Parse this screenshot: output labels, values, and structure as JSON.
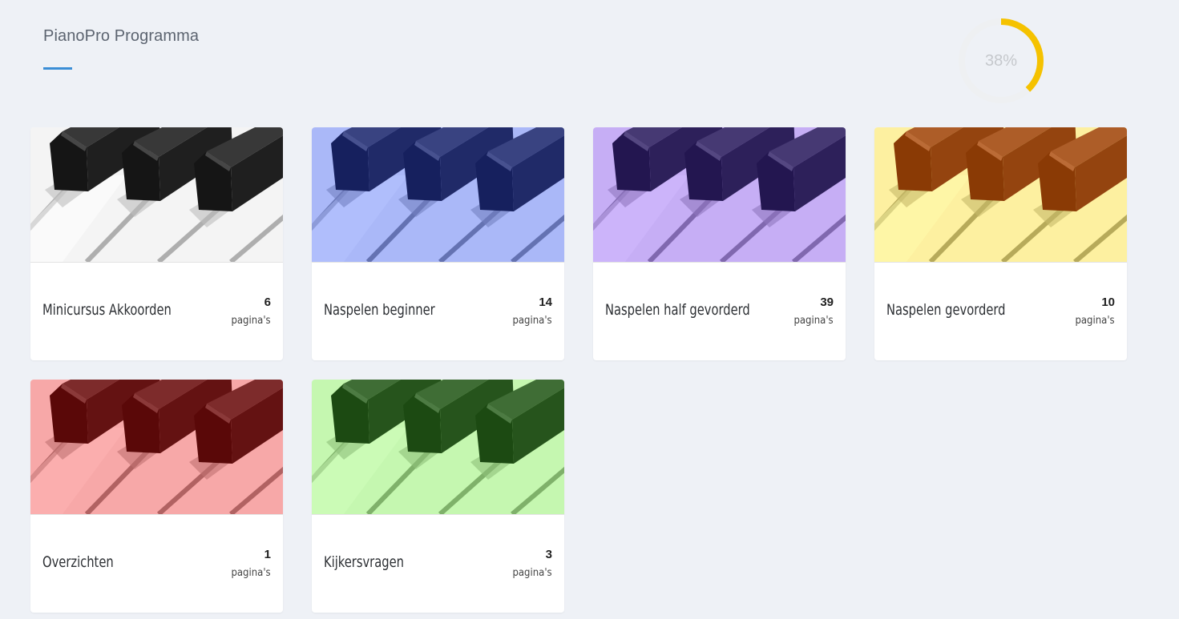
{
  "header": {
    "title": "PianoPro Programma"
  },
  "progress": {
    "label": "38%",
    "fraction": 0.38,
    "color": "#f5c200",
    "track_color": "#eef0f2"
  },
  "cards": [
    {
      "title": "Minicursus Akkoorden",
      "count": "6",
      "unit": "pagina's",
      "image": "piano-keys-image",
      "white_color": "#f4f4f4",
      "black_color": "#151515"
    },
    {
      "title": "Naspelen beginner",
      "count": "14",
      "unit": "pagina's",
      "image": "piano-keys-image",
      "white_color": "#aab8f8",
      "black_color": "#16205e"
    },
    {
      "title": "Naspelen half gevorderd",
      "count": "39",
      "unit": "pagina's",
      "image": "piano-keys-image",
      "white_color": "#c6aef5",
      "black_color": "#231650"
    },
    {
      "title": "Naspelen gevorderd",
      "count": "10",
      "unit": "pagina's",
      "image": "piano-keys-image",
      "white_color": "#fdf0a0",
      "black_color": "#8a3a05"
    },
    {
      "title": "Overzichten",
      "count": "1",
      "unit": "pagina's",
      "image": "piano-keys-image",
      "white_color": "#f7a8a8",
      "black_color": "#5a0808"
    },
    {
      "title": "Kijkersvragen",
      "count": "3",
      "unit": "pagina's",
      "image": "piano-keys-image",
      "white_color": "#c5f7b0",
      "black_color": "#1c4a12"
    }
  ]
}
